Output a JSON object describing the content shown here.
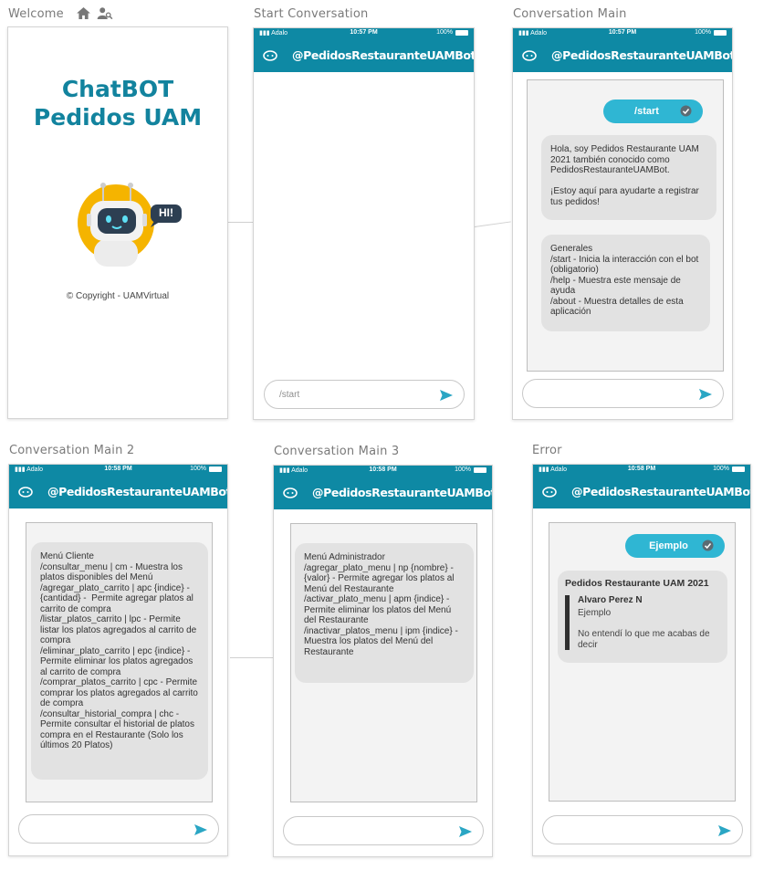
{
  "screens": {
    "welcome": {
      "title": "Welcome",
      "heading_line1": "ChatBOT",
      "heading_line2": "Pedidos UAM",
      "hi_badge": "HI!",
      "copyright": "© Copyright - UAMVirtual"
    },
    "start": {
      "title": "Start Conversation",
      "carrier": "Adalo",
      "time": "10:57 PM",
      "battery": "100%",
      "bot_name": "@PedidosRestauranteUAMBot",
      "input_placeholder": "/start"
    },
    "main": {
      "title": "Conversation Main",
      "carrier": "Adalo",
      "time": "10:57 PM",
      "battery": "100%",
      "bot_name": "@PedidosRestauranteUAMBot",
      "sent_message": "/start",
      "message1": "Hola, soy Pedidos Restaurante UAM 2021 también conocido como PedidosRestauranteUAMBot.\n\n¡Estoy aquí para ayudarte a registrar tus pedidos!",
      "message2": "Generales\n/start - Inicia la interacción con el bot (obligatorio)\n/help - Muestra este mensaje de ayuda\n/about - Muestra detalles de esta aplicación"
    },
    "main2": {
      "title": "Conversation Main 2",
      "carrier": "Adalo",
      "time": "10:58 PM",
      "battery": "100%",
      "bot_name": "@PedidosRestauranteUAMBot",
      "message": "Menú Cliente\n/consultar_menu | cm - Muestra los platos disponibles del Menú\n/agregar_plato_carrito | apc {indice} - {cantidad} -  Permite agregar platos al carrito de compra\n/listar_platos_carrito | lpc - Permite listar los platos agregados al carrito de compra\n/eliminar_plato_carrito | epc {indice} - Permite eliminar los platos agregados al carrito de compra\n/comprar_platos_carrito | cpc - Permite comprar los platos agregados al carrito de compra\n/consultar_historial_compra | chc - Permite consultar el historial de platos compra en el Restaurante (Solo los últimos 20 Platos)"
    },
    "main3": {
      "title": "Conversation Main 3",
      "carrier": "Adalo",
      "time": "10:58 PM",
      "battery": "100%",
      "bot_name": "@PedidosRestauranteUAMBot",
      "message": "Menú Administrador\n/agregar_plato_menu | np {nombre} - {valor} - Permite agregar los platos al Menú del Restaurante\n/activar_plato_menu | apm {indice} - Permite eliminar los platos del Menú del Restaurante\n/inactivar_platos_menu | ipm {indice} - Muestra los platos del Menú del Restaurante"
    },
    "error": {
      "title": "Error",
      "carrier": "Adalo",
      "time": "10:58 PM",
      "battery": "100%",
      "bot_name": "@PedidosRestauranteUAMBot",
      "sent_message": "Ejemplo",
      "card_title": "Pedidos Restaurante UAM 2021",
      "quote_author": "Alvaro Perez N",
      "quote_text": "Ejemplo",
      "reply_text": "No entendí lo que me acabas de decir"
    }
  },
  "icons": {
    "home": "home-icon",
    "users": "users-icon",
    "bot": "bot-icon",
    "send": "send-icon",
    "check": "check-icon",
    "signal": "signal-icon",
    "battery": "battery-icon"
  },
  "colors": {
    "header_teal": "#0e89a4",
    "title_teal": "#12839e",
    "pill_blue": "#2fb6d3",
    "bubble_gray": "#e2e2e2",
    "send_teal": "#2aa6c4",
    "robot_yellow": "#f5b400"
  }
}
